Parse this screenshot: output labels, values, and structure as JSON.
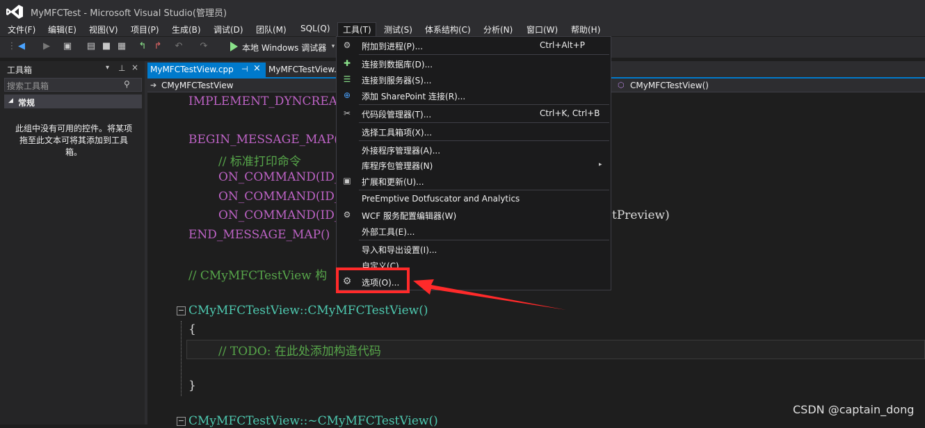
{
  "window": {
    "title": "MyMFCTest - Microsoft Visual Studio(管理员)"
  },
  "menubar": {
    "items": [
      "文件(F)",
      "编辑(E)",
      "视图(V)",
      "项目(P)",
      "生成(B)",
      "调试(D)",
      "团队(M)",
      "SQL(Q)",
      "工具(T)",
      "测试(S)",
      "体系结构(C)",
      "分析(N)",
      "窗口(W)",
      "帮助(H)"
    ],
    "active": "工具(T)"
  },
  "toolbar": {
    "debug_target": "本地 Windows 调试器"
  },
  "toolbox": {
    "title": "工具箱",
    "search_placeholder": "搜索工具箱",
    "group": "常规",
    "empty_message": "此组中没有可用的控件。将某项拖至此文本可将其添加到工具箱。"
  },
  "tabs": [
    {
      "label": "MyMFCTestView.cpp",
      "active": true
    },
    {
      "label": "MyMFCTestView.h",
      "active": false
    }
  ],
  "navbar": {
    "left": "CMyMFCTestView",
    "right": "CMyMFCTestView()"
  },
  "code_lines": [
    "IMPLEMENT_DYNCREATE(",
    "BEGIN_MESSAGE_MAP(CM",
    "// 标准打印命令",
    "ON_COMMAND(ID_FI",
    "ON_COMMAND(ID_FI",
    "ON_COMMAND(ID_FI",
    "tPreview)",
    "END_MESSAGE_MAP()",
    "// CMyMFCTestView 构",
    "CMyMFCTestView::CMyMFCTestView()",
    "{",
    "// TODO: 在此处添加构造代码",
    "}",
    "CMyMFCTestView::~CMyMFCTestView()"
  ],
  "tools_menu": {
    "items": [
      {
        "label": "附加到进程(P)...",
        "shortcut": "Ctrl+Alt+P",
        "icon": "attach-process-icon"
      },
      {
        "label": "连接到数据库(D)...",
        "shortcut": "",
        "icon": "connect-database-icon"
      },
      {
        "label": "连接到服务器(S)...",
        "shortcut": "",
        "icon": "connect-server-icon"
      },
      {
        "label": "添加 SharePoint 连接(R)...",
        "shortcut": "",
        "icon": "sharepoint-icon"
      },
      {
        "label": "代码段管理器(T)...",
        "shortcut": "Ctrl+K, Ctrl+B",
        "icon": "snippet-icon"
      },
      {
        "label": "选择工具箱项(X)...",
        "shortcut": "",
        "icon": ""
      },
      {
        "label": "外接程序管理器(A)...",
        "shortcut": "",
        "icon": ""
      },
      {
        "label": "库程序包管理器(N)",
        "shortcut": "",
        "icon": "",
        "submenu": true
      },
      {
        "label": "扩展和更新(U)...",
        "shortcut": "",
        "icon": "extensions-icon"
      },
      {
        "label": "PreEmptive Dotfuscator and Analytics",
        "shortcut": "",
        "icon": ""
      },
      {
        "label": "WCF 服务配置编辑器(W)",
        "shortcut": "",
        "icon": "wcf-gear-icon"
      },
      {
        "label": "外部工具(E)...",
        "shortcut": "",
        "icon": ""
      },
      {
        "label": "导入和导出设置(I)...",
        "shortcut": "",
        "icon": ""
      },
      {
        "label": "自定义(C)...",
        "shortcut": "",
        "icon": ""
      },
      {
        "label": "选项(O)...",
        "shortcut": "",
        "icon": "gear-icon"
      }
    ]
  },
  "annotation": {
    "highlight_color": "#ff2a2a"
  },
  "watermark": "CSDN @captain_dong"
}
